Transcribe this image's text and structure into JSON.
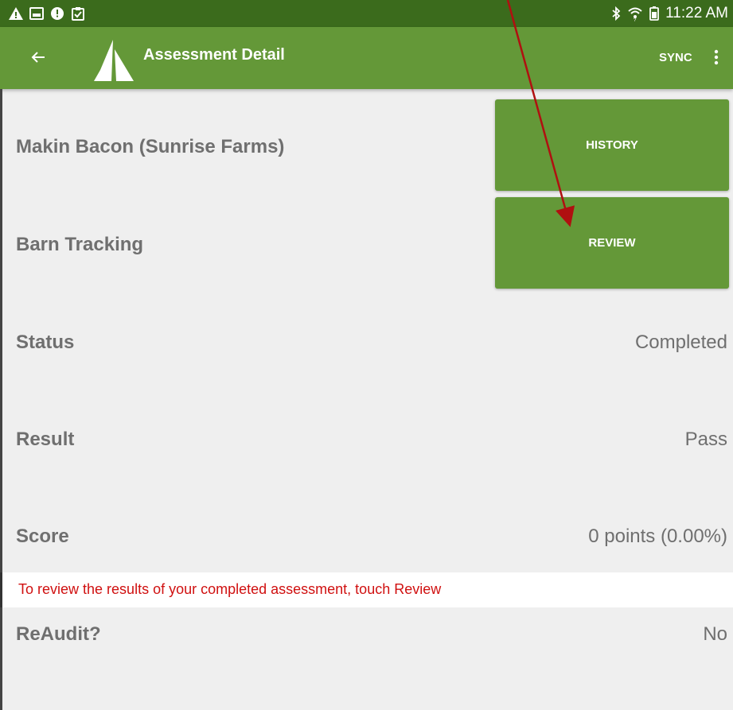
{
  "status_bar": {
    "left_icons": [
      "warning-icon",
      "gallery-icon",
      "alert-icon",
      "clipboard-icon"
    ],
    "right_icons": [
      "bluetooth-icon",
      "wifi-icon",
      "battery-icon"
    ],
    "time": "11:22 AM"
  },
  "app_bar": {
    "back_icon": "arrow-left-icon",
    "logo_icon": "sail-logo-icon",
    "title": "Assessment Detail",
    "sync_label": "SYNC",
    "menu_icon": "more-vert-icon"
  },
  "detail": {
    "farm_name": "Makin Bacon (Sunrise Farms)",
    "assessment_name": "Barn Tracking",
    "history_button": "HISTORY",
    "review_button": "REVIEW",
    "rows": [
      {
        "label": "Status",
        "value": "Completed"
      },
      {
        "label": "Result",
        "value": "Pass"
      },
      {
        "label": "Score",
        "value": "0 points (0.00%)"
      },
      {
        "label": "ReAudit?",
        "value": "No"
      }
    ]
  },
  "annotation": {
    "text": "To review the results of your completed assessment, touch Review",
    "color": "#d01010",
    "arrow_color": "#b01010"
  },
  "colors": {
    "status_bar": "#3b6b1c",
    "app_bar": "#649838",
    "button": "#649838",
    "background": "#efefef",
    "text": "#6f6f6f"
  }
}
